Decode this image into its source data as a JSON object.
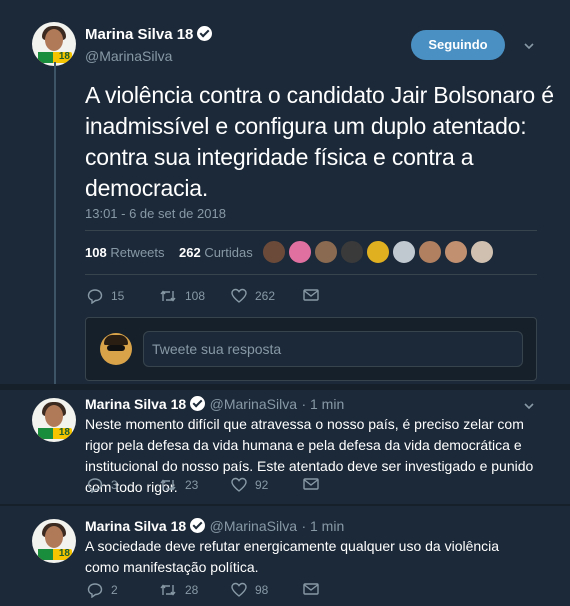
{
  "main_tweet": {
    "author_name": "Marina Silva 18",
    "author_handle": "@MarinaSilva",
    "avatar_badge": "18",
    "follow_label": "Seguindo",
    "text": "A violência contra o candidato Jair Bolsonaro é inadmissível e configura um duplo atentado: contra sua integridade física e contra a democracia.",
    "timestamp": "13:01 - 6 de set de 2018",
    "retweets_count": "108",
    "retweets_label": "Retweets",
    "likes_count": "262",
    "likes_label": "Curtidas",
    "reply_count": "15",
    "retweet_action_count": "108",
    "like_action_count": "262"
  },
  "reply_box": {
    "placeholder": "Tweete sua resposta"
  },
  "thread": [
    {
      "author_name": "Marina Silva 18",
      "author_handle": "@MarinaSilva",
      "time": "· 1 min",
      "avatar_badge": "18",
      "text": "Neste momento difícil que atravessa o nosso país, é preciso zelar com rigor pela defesa da vida humana e pela defesa da vida democrática e institucional do nosso país. Este atentado deve ser investigado e punido com todo rigor.",
      "replies": "3",
      "retweets": "23",
      "likes": "92"
    },
    {
      "author_name": "Marina Silva 18",
      "author_handle": "@MarinaSilva",
      "time": "· 1 min",
      "avatar_badge": "18",
      "text": "A sociedade deve refutar energicamente qualquer uso da violência como manifestação política.",
      "replies": "2",
      "retweets": "28",
      "likes": "98"
    }
  ],
  "likers_colors": [
    "#6b4a3a",
    "#e070a0",
    "#8a6a50",
    "#3a3a3a",
    "#e0b020",
    "#c0c8d0",
    "#b08060",
    "#c09070",
    "#d0c0b0"
  ],
  "colors": {
    "background": "#1c2938",
    "follow_button": "#4a90c2",
    "secondary_text": "#8899a6",
    "divider": "#38444d"
  }
}
